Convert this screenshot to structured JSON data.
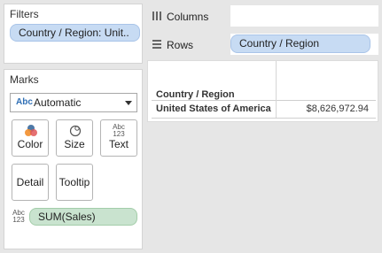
{
  "filters": {
    "title": "Filters",
    "pill_label": "Country / Region: Unit.."
  },
  "marks": {
    "title": "Marks",
    "mark_type_icon": "Abc",
    "mark_type": "Automatic",
    "buttons": {
      "color": "Color",
      "size": "Size",
      "text": "Text",
      "text_icon_top": "Abc",
      "text_icon_bottom": "123",
      "detail": "Detail",
      "tooltip": "Tooltip"
    },
    "field_icon_top": "Abc",
    "field_icon_bottom": "123",
    "field_pill": "SUM(Sales)"
  },
  "shelves": {
    "columns_label": "Columns",
    "rows_label": "Rows",
    "rows_pill": "Country / Region"
  },
  "table": {
    "header": "Country / Region",
    "row_label": "United States of America",
    "row_value": "$8,626,972.94"
  },
  "colors": {
    "pill_blue": "#c7dbf3",
    "pill_green": "#c9e3cf",
    "background": "#e6e6e6"
  }
}
